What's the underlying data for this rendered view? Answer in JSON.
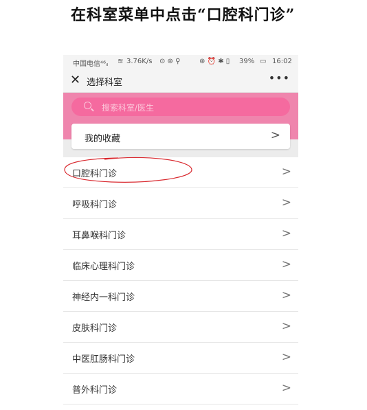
{
  "heading": "在科室菜单中点击“口腔科门诊”",
  "statusbar": {
    "carrier": "中国电信⁴⁶ᵢₗ",
    "speed": "3.76K/s",
    "misc": "⊙ ⊛ ⚲",
    "icons": "⊛ ⏰ ✱ ▯",
    "battery": "39%",
    "time": "16:02"
  },
  "titlebar": {
    "title": "选择科室",
    "close": "✕",
    "more": "•••"
  },
  "search": {
    "placeholder": "搜索科室/医生"
  },
  "favorites": {
    "label": "我的收藏",
    "chevron": ">"
  },
  "departments": [
    {
      "label": "口腔科门诊",
      "chevron": ">"
    },
    {
      "label": "呼吸科门诊",
      "chevron": ">"
    },
    {
      "label": "耳鼻喉科门诊",
      "chevron": ">"
    },
    {
      "label": "临床心理科门诊",
      "chevron": ">"
    },
    {
      "label": "神经内一科门诊",
      "chevron": ">"
    },
    {
      "label": "皮肤科门诊",
      "chevron": ">"
    },
    {
      "label": "中医肛肠科门诊",
      "chevron": ">"
    },
    {
      "label": "普外科门诊",
      "chevron": ">"
    }
  ],
  "colors": {
    "accent": "#ef85ad",
    "search_bg": "#f56a9f",
    "annotation": "#d9292f"
  }
}
